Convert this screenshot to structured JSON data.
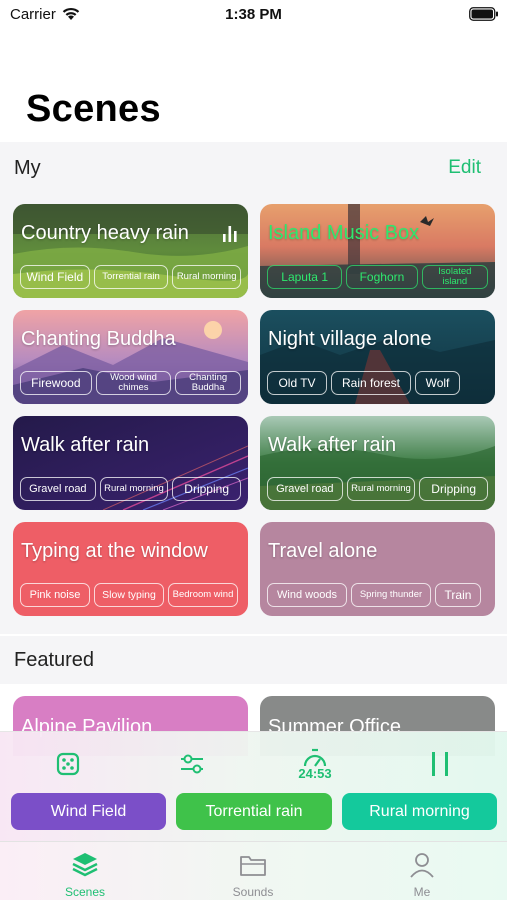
{
  "status": {
    "carrier": "Carrier",
    "time": "1:38 PM"
  },
  "page": {
    "title": "Scenes"
  },
  "my": {
    "title": "My",
    "edit": "Edit",
    "cards": [
      {
        "title": "Country heavy rain",
        "tags": [
          "Wind Field",
          "Torrential rain",
          "Rural morning"
        ],
        "playing": true
      },
      {
        "title": "Island Music Box",
        "tags": [
          "Laputa 1",
          "Foghorn",
          "Isolated island"
        ]
      },
      {
        "title": "Chanting Buddha",
        "tags": [
          "Firewood",
          "Wood wind chimes",
          "Chanting Buddha"
        ]
      },
      {
        "title": "Night village alone",
        "tags": [
          "Old TV",
          "Rain forest",
          "Wolf"
        ]
      },
      {
        "title": "Walk after rain",
        "tags": [
          "Gravel road",
          "Rural morning",
          "Dripping"
        ]
      },
      {
        "title": "Walk after rain",
        "tags": [
          "Gravel road",
          "Rural morning",
          "Dripping"
        ]
      },
      {
        "title": "Typing at the window",
        "tags": [
          "Pink noise",
          "Slow typing",
          "Bedroom wind"
        ]
      },
      {
        "title": "Travel alone",
        "tags": [
          "Wind woods",
          "Spring thunder",
          "Train"
        ]
      }
    ]
  },
  "featured": {
    "title": "Featured",
    "cards": [
      {
        "title": "Alpine Pavilion"
      },
      {
        "title": "Summer Office"
      }
    ]
  },
  "player": {
    "timer": "24:53",
    "chips": [
      "Wind Field",
      "Torrential rain",
      "Rural morning"
    ],
    "icons": [
      "dice-icon",
      "sliders-icon",
      "timer-icon",
      "pause-icon"
    ]
  },
  "tabs": [
    {
      "label": "Scenes",
      "active": true,
      "icon": "layers-icon"
    },
    {
      "label": "Sounds",
      "active": false,
      "icon": "folder-icon"
    },
    {
      "label": "Me",
      "active": false,
      "icon": "person-icon"
    }
  ],
  "colors": {
    "accent": "#1fbf73",
    "chip_purple": "#7b4fc8",
    "chip_green": "#3fc24a",
    "chip_teal": "#14c99c"
  }
}
